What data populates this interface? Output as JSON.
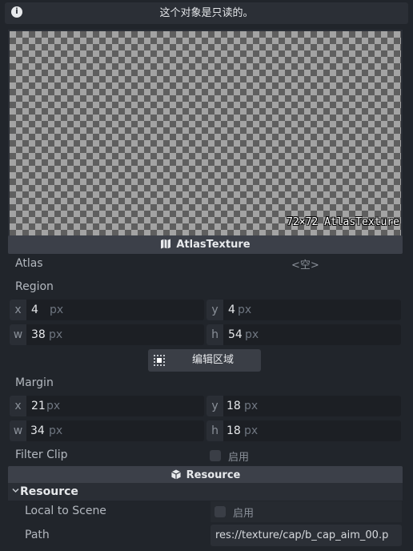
{
  "banner": {
    "text": "这个对象是只读的。",
    "icon": "info-icon"
  },
  "preview": {
    "label": "72×72 AtlasTexture"
  },
  "section": {
    "title": "AtlasTexture",
    "icon": "map-icon"
  },
  "atlas": {
    "label": "Atlas",
    "value": "<空>"
  },
  "region": {
    "label": "Region",
    "x": {
      "axis": "x",
      "value": "4",
      "unit": "px"
    },
    "y": {
      "axis": "y",
      "value": "4",
      "unit": "px"
    },
    "w": {
      "axis": "w",
      "value": "38",
      "unit": "px"
    },
    "h": {
      "axis": "h",
      "value": "54",
      "unit": "px"
    }
  },
  "edit_region": {
    "label": "编辑区域",
    "icon": "region-edit-icon"
  },
  "margin": {
    "label": "Margin",
    "x": {
      "axis": "x",
      "value": "21",
      "unit": "px"
    },
    "y": {
      "axis": "y",
      "value": "18",
      "unit": "px"
    },
    "w": {
      "axis": "w",
      "value": "34",
      "unit": "px"
    },
    "h": {
      "axis": "h",
      "value": "18",
      "unit": "px"
    }
  },
  "filter_clip": {
    "label": "Filter Clip",
    "checkbox_label": "启用",
    "checked": false
  },
  "resource_section": {
    "title": "Resource",
    "icon": "cube-icon"
  },
  "resource_group": {
    "title": "Resource",
    "icon": "chevron-down-icon"
  },
  "local_to_scene": {
    "label": "Local to Scene",
    "checkbox_label": "启用",
    "checked": false
  },
  "path": {
    "label": "Path",
    "value": "res://texture/cap/b_cap_aim_00.p"
  },
  "colors": {
    "background": "#21252b",
    "header": "#3c4049",
    "field": "#1c1f24"
  }
}
